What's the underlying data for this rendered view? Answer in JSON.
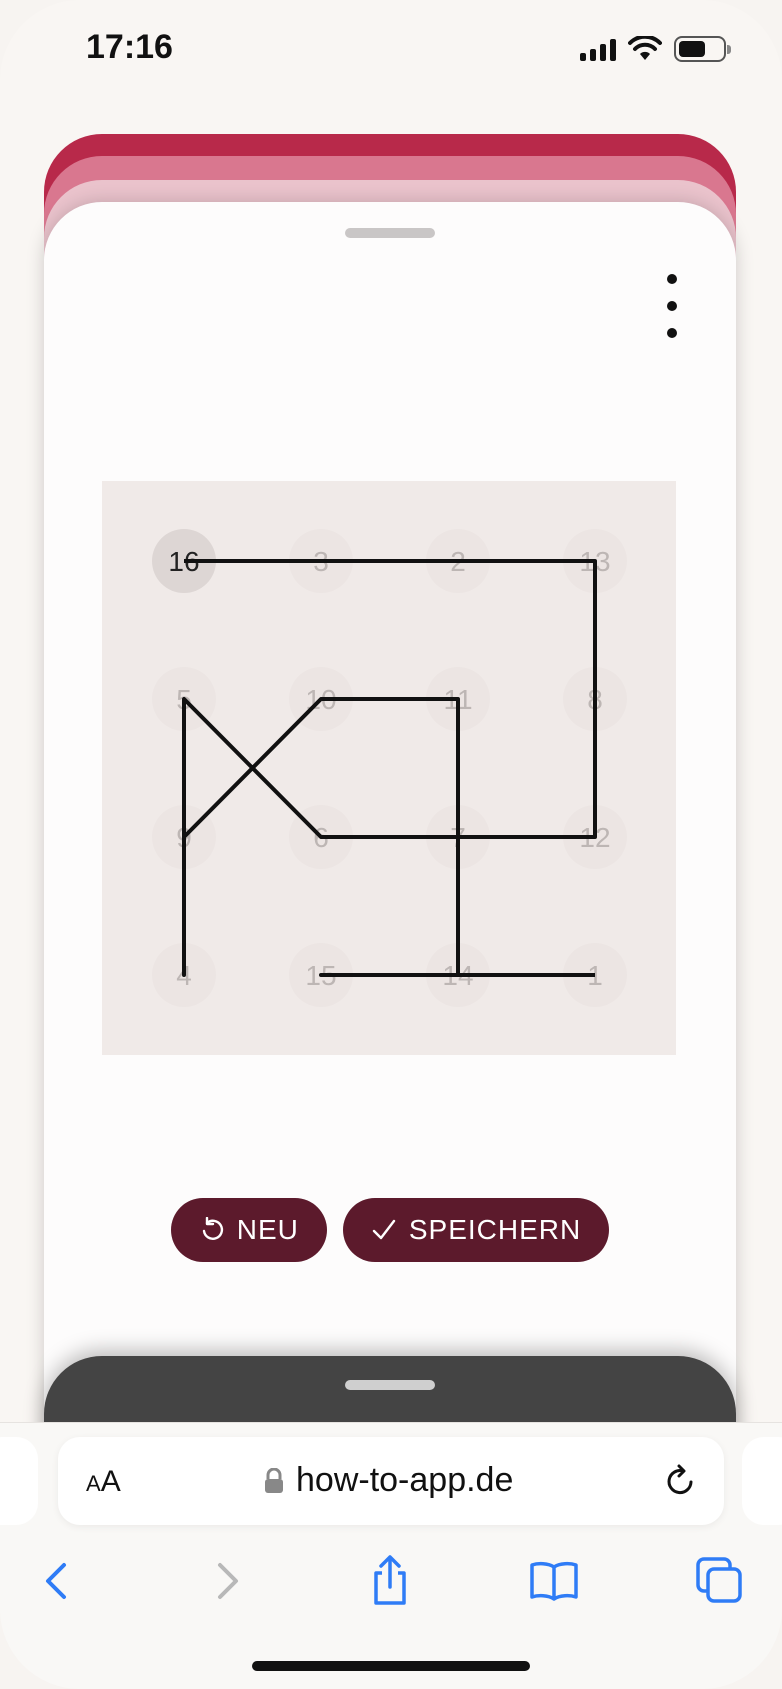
{
  "status_bar": {
    "time": "17:16"
  },
  "puzzle": {
    "highlighted": "16",
    "grid": [
      [
        "16",
        "3",
        "2",
        "13"
      ],
      [
        "5",
        "10",
        "11",
        "8"
      ],
      [
        "9",
        "6",
        "7",
        "12"
      ],
      [
        "4",
        "15",
        "14",
        "1"
      ]
    ],
    "path": [
      "16",
      "3",
      "2",
      "13",
      "8",
      "12",
      "7",
      "6",
      "5",
      "4",
      "9",
      "10",
      "11",
      "14",
      "15",
      "1"
    ]
  },
  "buttons": {
    "new_label": "NEU",
    "save_label": "SPEICHERN"
  },
  "browser": {
    "aa_label_small": "A",
    "aa_label_big": "A",
    "url": "how-to-app.de"
  },
  "colors": {
    "sheet1": "#b8294a",
    "sheet2": "#d9778f",
    "sheet3": "#eac3cc",
    "button": "#5c1a2c",
    "ios_blue": "#2f7cf6"
  }
}
